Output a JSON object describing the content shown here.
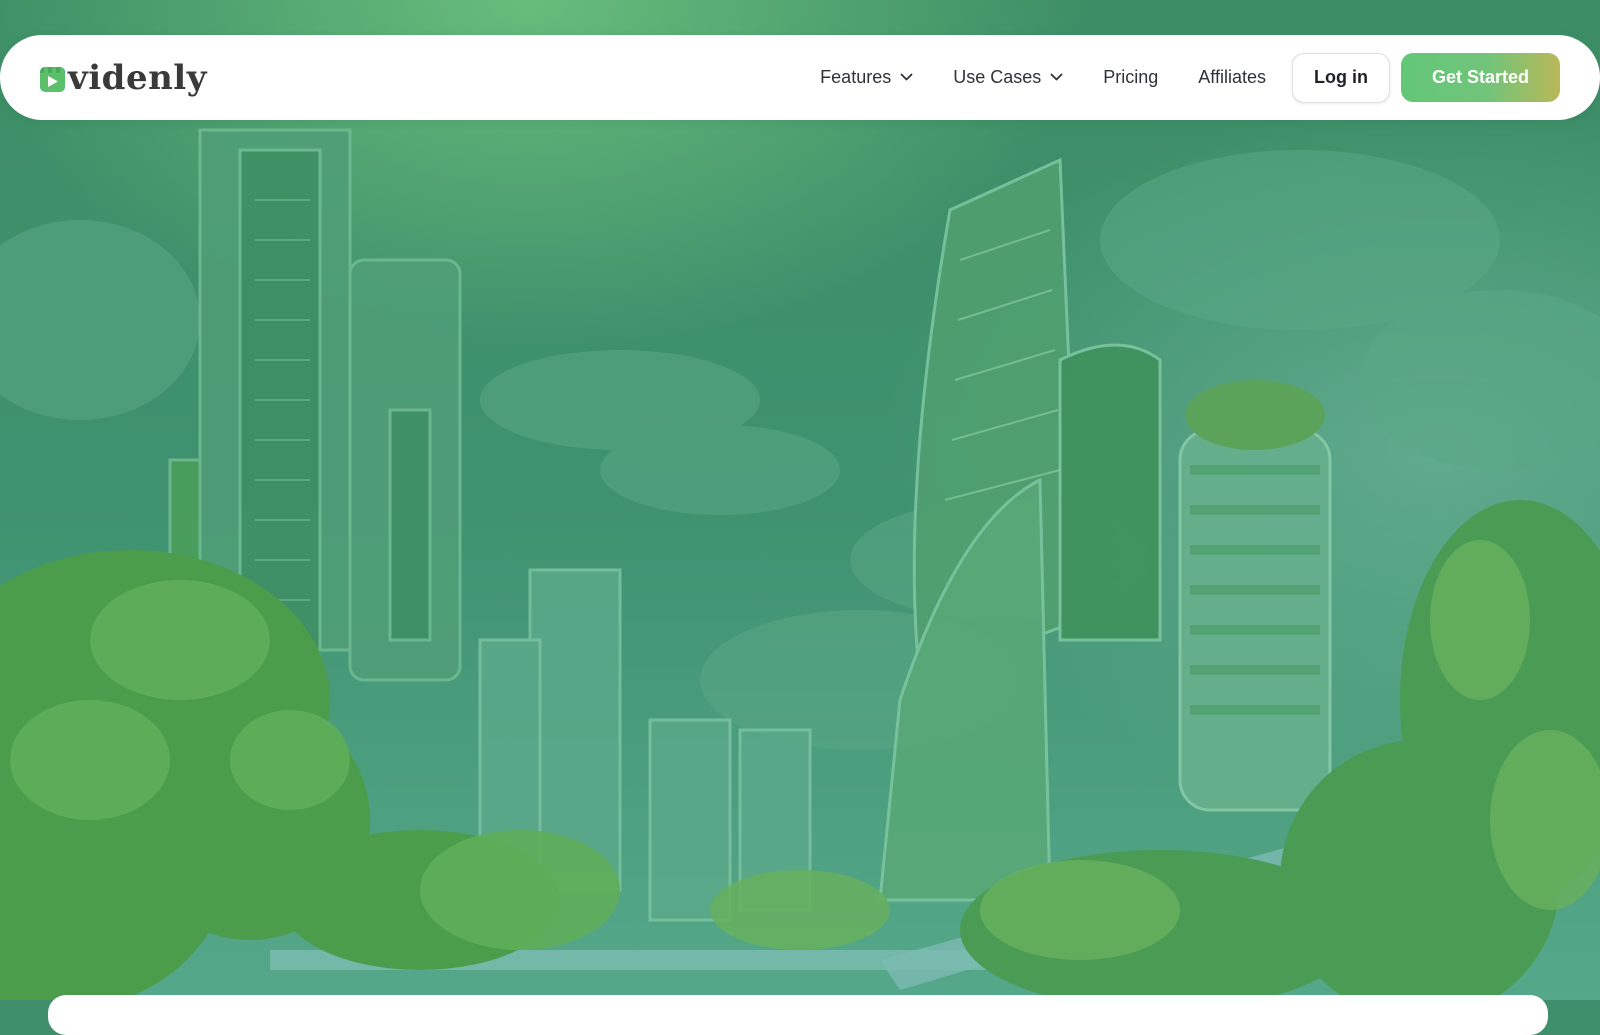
{
  "colors": {
    "brand_green": "#5bbf6c",
    "hero_sky": "#3f8f6c",
    "cta_gradient_start": "#63c777",
    "cta_gradient_end": "#b9b858",
    "nav_text": "#2f3338"
  },
  "brand": {
    "name": "videnly",
    "icon": "video-play-icon"
  },
  "nav": {
    "items": [
      {
        "label": "Features",
        "has_dropdown": true,
        "icon": "chevron-down-icon"
      },
      {
        "label": "Use Cases",
        "has_dropdown": true,
        "icon": "chevron-down-icon"
      },
      {
        "label": "Pricing",
        "has_dropdown": false
      },
      {
        "label": "Affiliates",
        "has_dropdown": false
      }
    ],
    "login_label": "Log in",
    "cta_label": "Get Started"
  },
  "hero": {
    "background": "futuristic-green-city-illustration"
  }
}
